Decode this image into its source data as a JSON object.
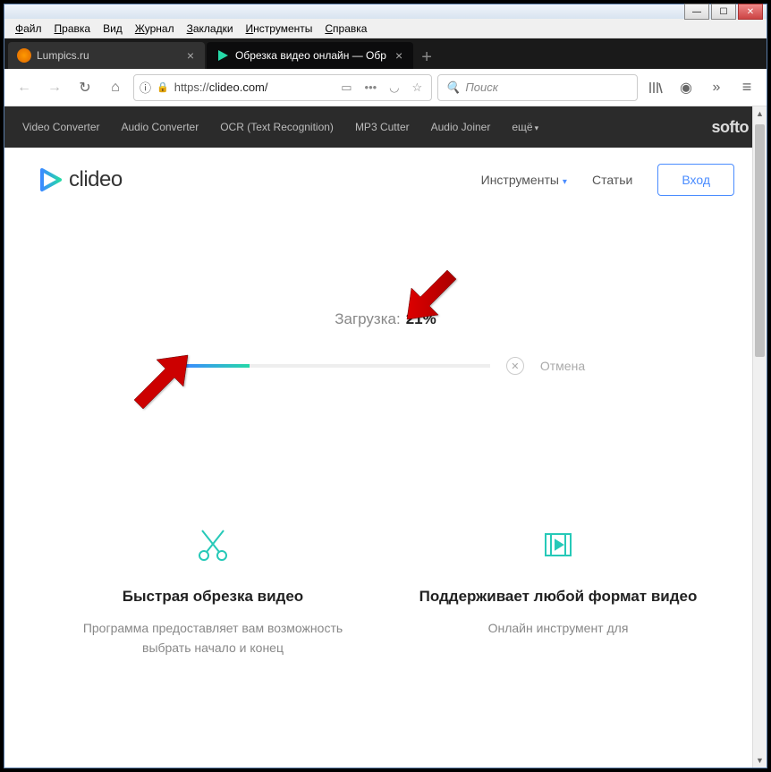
{
  "menubar": [
    "Файл",
    "Правка",
    "Вид",
    "Журнал",
    "Закладки",
    "Инструменты",
    "Справка"
  ],
  "tabs": [
    {
      "title": "Lumpics.ru",
      "active": false
    },
    {
      "title": "Обрезка видео онлайн — Обр",
      "active": true
    }
  ],
  "url": {
    "scheme": "https://",
    "host": "clideo.com/"
  },
  "search_placeholder": "Поиск",
  "softo": {
    "items": [
      "Video Converter",
      "Audio Converter",
      "OCR (Text Recognition)",
      "MP3 Cutter",
      "Audio Joiner"
    ],
    "more": "ещё",
    "brand": "softo"
  },
  "brand": "clideo",
  "header_nav": {
    "tools": "Инструменты",
    "articles": "Статьи",
    "login": "Вход"
  },
  "upload": {
    "label": "Загрузка:",
    "percent_text": "21%",
    "percent": 21,
    "cancel": "Отмена"
  },
  "features": [
    {
      "title": "Быстрая обрезка видео",
      "desc": "Программа предоставляет вам возможность выбрать начало и конец"
    },
    {
      "title": "Поддерживает любой формат видео",
      "desc": "Онлайн инструмент для"
    }
  ]
}
